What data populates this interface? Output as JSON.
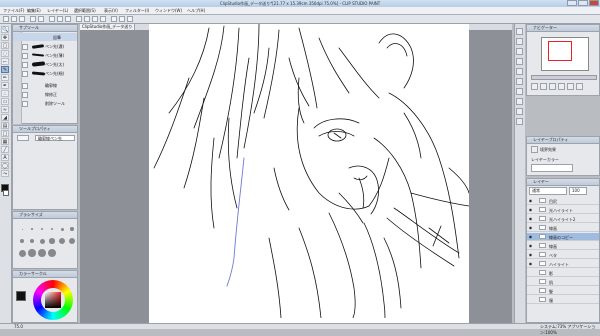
{
  "window": {
    "title": "ClipStudio作画_データ送り*[21.77 x 15.39cm 350dpi 75.0%] - CLIP STUDIO PAINT"
  },
  "menu": [
    "ファイル(F)",
    "編集(E)",
    "レイヤー(L)",
    "選択範囲(S)",
    "表示(V)",
    "フィルター(I)",
    "ウィンドウ(W)",
    "ヘルプ(H)"
  ],
  "toolbar": {
    "icons": [
      "new-icon",
      "open-icon",
      "save-icon",
      "undo-icon",
      "redo-icon",
      "delete-icon",
      "clear-icon",
      "transform-icon",
      "select-all-icon",
      "deselect-icon",
      "crop-icon",
      "invert-icon",
      "snap-icon",
      "ruler-icon",
      "grid-icon"
    ]
  },
  "left": {
    "subtool": {
      "title": "サブツール",
      "header_item": "鉛筆",
      "items": [
        {
          "label": "ペン先(濃)",
          "stroke": "solid"
        },
        {
          "label": "ペン先(薄)",
          "stroke": "solid"
        },
        {
          "label": "ペン先(太)",
          "stroke": "solid"
        },
        {
          "label": "ペン先(細)",
          "stroke": "solid"
        },
        {
          "label": "輪郭線",
          "stroke": "none"
        },
        {
          "label": "線修正",
          "stroke": "none"
        },
        {
          "label": "削除ツール",
          "stroke": "none"
        }
      ]
    },
    "toolprop": {
      "title": "ツールプロパティ",
      "dropdown": "輪郭線ペン先"
    },
    "brush": {
      "title": "ブラシサイズ"
    },
    "color": {
      "title": "カラーサークル"
    }
  },
  "right": {
    "navigator": {
      "title": "ナビゲーター",
      "zoom": "75.0"
    },
    "layerprop": {
      "title": "レイヤープロパティ",
      "effect": "境界効果",
      "subtitle": "レイヤーカラー"
    },
    "layers": {
      "title": "レイヤー",
      "blend": "通常",
      "opacity": "100",
      "rows": [
        {
          "name": "目尻",
          "visible": true,
          "selected": false
        },
        {
          "name": "光ハイライト",
          "visible": true,
          "selected": false
        },
        {
          "name": "光ハイライト2",
          "visible": true,
          "selected": false
        },
        {
          "name": "線画",
          "visible": true,
          "selected": false
        },
        {
          "name": "線画のコピー",
          "visible": true,
          "selected": true
        },
        {
          "name": "線画",
          "visible": true,
          "selected": false
        },
        {
          "name": "ベタ",
          "visible": true,
          "selected": false
        },
        {
          "name": "ハイライト",
          "visible": true,
          "selected": false
        },
        {
          "name": "影",
          "visible": false,
          "selected": false
        },
        {
          "name": "肌",
          "visible": false,
          "selected": false
        },
        {
          "name": "髪",
          "visible": false,
          "selected": false
        },
        {
          "name": "服",
          "visible": false,
          "selected": false
        }
      ]
    }
  },
  "status": {
    "zoom": "75.0",
    "memory": "システム:73%  アプリケーション:100%"
  },
  "colors": {
    "selection": "#9fbbe0",
    "panel_bg": "#e6e8eb",
    "canvas_bg": "#8d9197"
  }
}
